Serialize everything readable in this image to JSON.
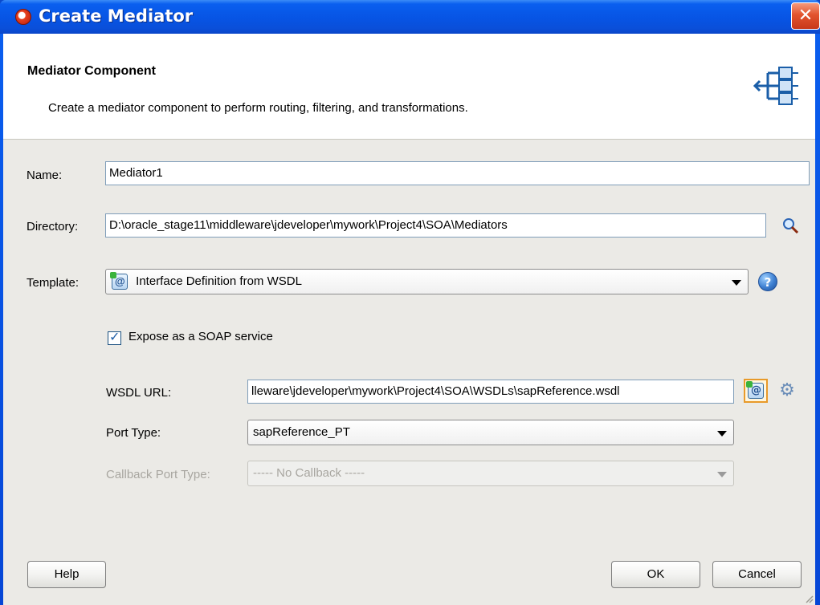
{
  "window": {
    "title": "Create Mediator",
    "close_glyph": "✕"
  },
  "header": {
    "title": "Mediator Component",
    "description": "Create a mediator component to perform routing, filtering, and transformations.",
    "icon": "mediator-diagram-icon"
  },
  "form": {
    "name_label": "Name:",
    "name_value": "Mediator1",
    "directory_label": "Directory:",
    "directory_value": "D:\\oracle_stage11\\middleware\\jdeveloper\\mywork\\Project4\\SOA\\Mediators",
    "template_label": "Template:",
    "template_value": "Interface Definition from WSDL",
    "expose_soap_label": "Expose as a SOAP service",
    "expose_soap_checked": true,
    "wsdl_url_label": "WSDL URL:",
    "wsdl_url_value": "lleware\\jdeveloper\\mywork\\Project4\\SOA\\WSDLs\\sapReference.wsdl",
    "port_type_label": "Port Type:",
    "port_type_value": "sapReference_PT",
    "callback_port_type_label": "Callback Port Type:",
    "callback_port_type_value": "----- No Callback -----"
  },
  "buttons": {
    "help": "Help",
    "ok": "OK",
    "cancel": "Cancel"
  },
  "icons": {
    "search": "search-icon",
    "help": "help-icon",
    "wsdl_browse": "wsdl-browse-icon",
    "gear": "gear-icon"
  },
  "colors": {
    "titlebar": "#0754e4",
    "client": "#ebeae6",
    "close": "#e2542e"
  }
}
